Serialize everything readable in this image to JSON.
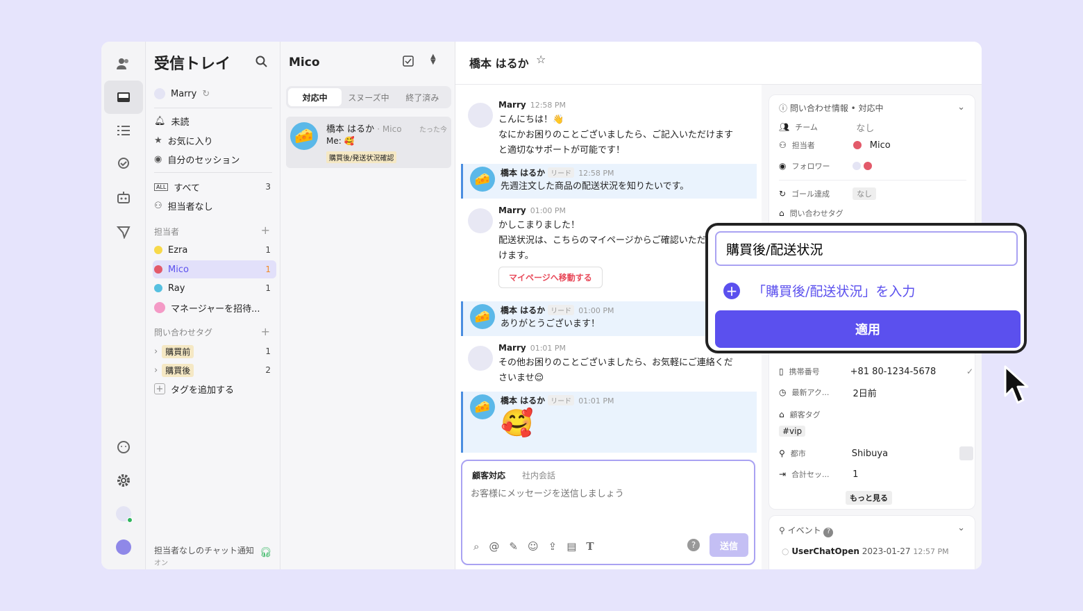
{
  "rail": {
    "icons": [
      "people-icon",
      "inbox-icon",
      "list-icon",
      "goal-icon",
      "bot-icon",
      "send-icon",
      "chat-status-icon",
      "gear-icon",
      "user-avatar-icon",
      "workspace-avatar-icon"
    ]
  },
  "sidebar": {
    "title": "受信トレイ",
    "user": "Marry",
    "items": [
      {
        "label": "未読"
      },
      {
        "label": "お気に入り"
      },
      {
        "label": "自分のセッション"
      }
    ],
    "all": {
      "label": "すべて",
      "count": "3"
    },
    "unassigned": {
      "label": "担当者なし"
    },
    "assignee_section": "担当者",
    "assignees": [
      {
        "label": "Ezra",
        "count": "1"
      },
      {
        "label": "Mico",
        "count": "1"
      },
      {
        "label": "Ray",
        "count": "1"
      },
      {
        "label": "マネージャーを招待..."
      }
    ],
    "tag_section": "問い合わせタグ",
    "tags": [
      {
        "label": "購買前",
        "count": "1"
      },
      {
        "label": "購買後",
        "count": "2"
      }
    ],
    "add_tag": "タグを追加する",
    "footer": {
      "label": "担当者なしのチャット通知",
      "sub": "オン"
    }
  },
  "list": {
    "title": "Mico",
    "tabs": [
      "対応中",
      "スヌーズ中",
      "終了済み"
    ],
    "card": {
      "name": "橋本 はるか",
      "assignee": "· Mico",
      "time": "たった今",
      "preview": "Me: 🥰",
      "tag": "購買後/発送状況確認"
    }
  },
  "chat": {
    "title": "橋本 はるか",
    "messages": [
      {
        "name": "Marry",
        "time": "12:58 PM",
        "text": "こんにちは！👋\nなにかお困りのことございましたら、ご記入いただけますと適切なサポートが可能です！"
      },
      {
        "name": "橋本 はるか",
        "lead": "リード",
        "time": "12:58 PM",
        "text": "先週注文した商品の配送状況を知りたいです。"
      },
      {
        "name": "Marry",
        "time": "01:00 PM",
        "text": "かしこまりました！\n配送状況は、こちらのマイページからご確認いただけます。",
        "button": "マイページへ移動する"
      },
      {
        "name": "橋本 はるか",
        "lead": "リード",
        "time": "01:00 PM",
        "text": "ありがとうございます！"
      },
      {
        "name": "Marry",
        "time": "01:01 PM",
        "text": "その他お困りのことございましたら、お気軽にご連絡くださいませ😌"
      },
      {
        "name": "橋本 はるか",
        "lead": "リード",
        "time": "01:01 PM",
        "text": "🥰"
      }
    ],
    "composer": {
      "tab_customer": "顧客対応",
      "tab_internal": "社内会話",
      "placeholder": "お客様にメッセージを送信しましょう",
      "send": "送信"
    }
  },
  "profile": {
    "info_title": "問い合わせ情報 • 対応中",
    "team": {
      "k": "チーム",
      "v": "なし"
    },
    "assignee": {
      "k": "担当者",
      "v": "Mico"
    },
    "follower": {
      "k": "フォロワー"
    },
    "goal": {
      "k": "ゴール達成",
      "v": "なし"
    },
    "chat_tag": {
      "k": "問い合わせタグ"
    },
    "phone": {
      "k": "携帯番号",
      "v": "+81 80-1234-5678"
    },
    "last": {
      "k": "最新アク...",
      "v": "2日前"
    },
    "cust_tag": {
      "k": "顧客タグ",
      "v": "#vip"
    },
    "city": {
      "k": "都市",
      "v": "Shibuya"
    },
    "sessions": {
      "k": "合計セッ...",
      "v": "1"
    },
    "more": "もっと見る",
    "event_title": "イベント",
    "event": {
      "name": "UserChatOpen",
      "date": "2023-01-27",
      "time": "12:57 PM"
    }
  },
  "popup": {
    "input": "購買後/配送状況",
    "suggest": "「購買後/配送状況」を入力",
    "apply": "適用"
  },
  "colors": {
    "accent": "#5b50ee",
    "bg": "#e6e4fc"
  }
}
